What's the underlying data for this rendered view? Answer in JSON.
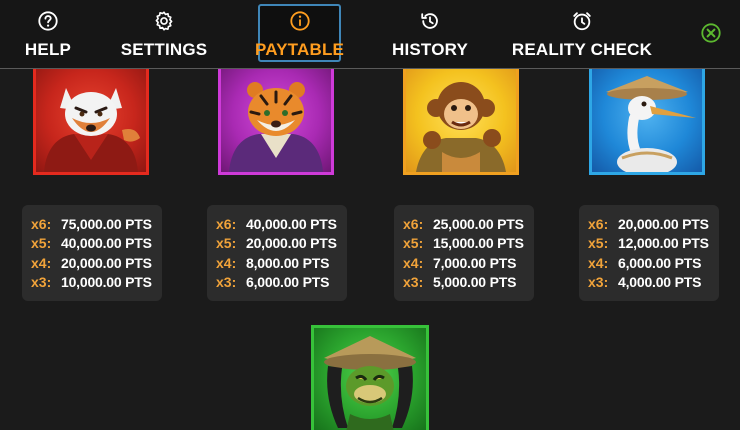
{
  "nav": {
    "items": [
      {
        "label": "HELP",
        "icon": "help-icon"
      },
      {
        "label": "SETTINGS",
        "icon": "gear-icon"
      },
      {
        "label": "PAYTABLE",
        "icon": "info-icon",
        "active": true
      },
      {
        "label": "HISTORY",
        "icon": "history-icon"
      },
      {
        "label": "REALITY CHECK",
        "icon": "alarm-clock-icon"
      }
    ],
    "close_icon": "close-icon",
    "active_color": "#ff9d1f",
    "close_color": "#5cb82f"
  },
  "paytable": {
    "symbols": [
      {
        "name": "fox",
        "frame_color": "#e52a1e",
        "bg_color": "#c7261c",
        "pays": [
          {
            "mult": "x6:",
            "amount": "75,000.00 PTS"
          },
          {
            "mult": "x5:",
            "amount": "40,000.00 PTS"
          },
          {
            "mult": "x4:",
            "amount": "20,000.00 PTS"
          },
          {
            "mult": "x3:",
            "amount": "10,000.00 PTS"
          }
        ]
      },
      {
        "name": "tiger",
        "frame_color": "#cf3ad9",
        "bg_color": "#a92ab3",
        "pays": [
          {
            "mult": "x6:",
            "amount": "40,000.00 PTS"
          },
          {
            "mult": "x5:",
            "amount": "20,000.00 PTS"
          },
          {
            "mult": "x4:",
            "amount": "8,000.00 PTS"
          },
          {
            "mult": "x3:",
            "amount": "6,000.00 PTS"
          }
        ]
      },
      {
        "name": "monkey",
        "frame_color": "#f0a020",
        "bg_color": "#f4c21f",
        "pays": [
          {
            "mult": "x6:",
            "amount": "25,000.00 PTS"
          },
          {
            "mult": "x5:",
            "amount": "15,000.00 PTS"
          },
          {
            "mult": "x4:",
            "amount": "7,000.00 PTS"
          },
          {
            "mult": "x3:",
            "amount": "5,000.00 PTS"
          }
        ]
      },
      {
        "name": "crane",
        "frame_color": "#2ea7e6",
        "bg_color": "#1f88d8",
        "pays": [
          {
            "mult": "x6:",
            "amount": "20,000.00 PTS"
          },
          {
            "mult": "x5:",
            "amount": "12,000.00 PTS"
          },
          {
            "mult": "x4:",
            "amount": "6,000.00 PTS"
          },
          {
            "mult": "x3:",
            "amount": "4,000.00 PTS"
          }
        ]
      },
      {
        "name": "snake",
        "frame_color": "#37c23a",
        "bg_color": "#2aa22d",
        "pays": []
      }
    ]
  }
}
